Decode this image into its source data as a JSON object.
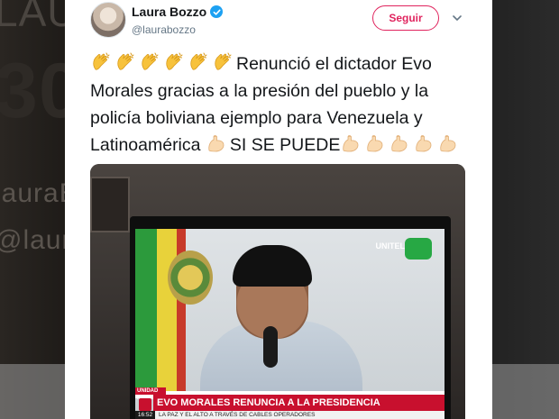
{
  "tweet": {
    "author_name": "Laura Bozzo",
    "author_handle": "@laurabozzo",
    "verified": true,
    "follow_label": "Seguir",
    "text_main": "Renunció el dictador Evo Morales gracias a la presión del pueblo y la policía boliviana ejemplo para Venezuela y Latinoamérica",
    "text_tail": "SI SE PUEDE",
    "leading_emoji": "clapping-hands",
    "leading_emoji_count": 6,
    "middle_emoji": "flexed-biceps",
    "trailing_emoji": "flexed-biceps",
    "trailing_emoji_count": 5
  },
  "media": {
    "tv_ticker_live": "UNIDAD MOVIL",
    "tv_ticker_headline": "EVO MORALES RENUNCIA A LA PRESIDENCIA",
    "tv_ticker_time": "16:52",
    "tv_ticker_subline": "LA PAZ Y EL ALTO A TRAVÉS DE CABLES OPERADORES",
    "tv_channel_logo": "UNITEL"
  },
  "background": {
    "line1": "LAU",
    "line2": "30",
    "line3": "lauraBo",
    "line4": "@laura"
  },
  "colors": {
    "follow_accent": "#e0245e",
    "verified_badge": "#1da1f2",
    "handle_gray": "#657786",
    "text_dark": "#14171a"
  }
}
